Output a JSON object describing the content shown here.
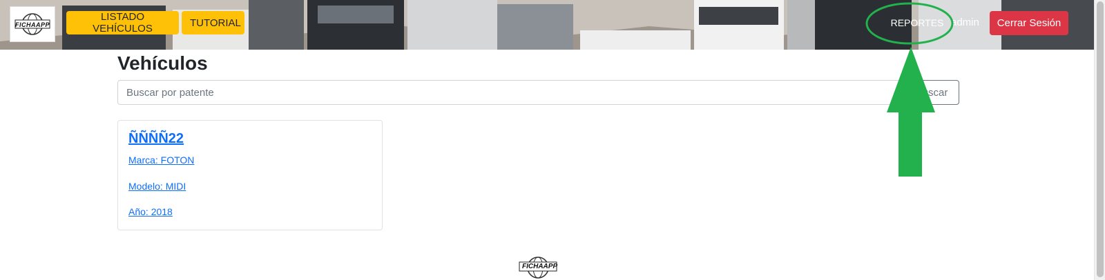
{
  "header": {
    "logo_text": "FICHAAPP",
    "nav": [
      {
        "label": "LISTADO VEHÍCULOS"
      },
      {
        "label": "TUTORIAL"
      }
    ],
    "reports_label": "REPORTES",
    "username": "admin",
    "logout_label": "Cerrar Sesión"
  },
  "main": {
    "title": "Vehículos",
    "search": {
      "placeholder": "Buscar por patente",
      "button_label": "Buscar"
    },
    "vehicles": [
      {
        "plate": "ÑÑÑÑ22",
        "marca": "Marca: FOTON",
        "modelo": "Modelo: MIDI",
        "anio": "Año: 2018"
      }
    ]
  },
  "footer": {
    "logo_text": "FICHAAPP"
  },
  "colors": {
    "accent_yellow": "#ffc107",
    "danger_red": "#dc3545",
    "link_blue": "#0d6efd",
    "annotation_green": "#22b14c"
  },
  "icons": {
    "logo": "globe-emblem-icon",
    "annotation": "arrow-up-icon"
  }
}
